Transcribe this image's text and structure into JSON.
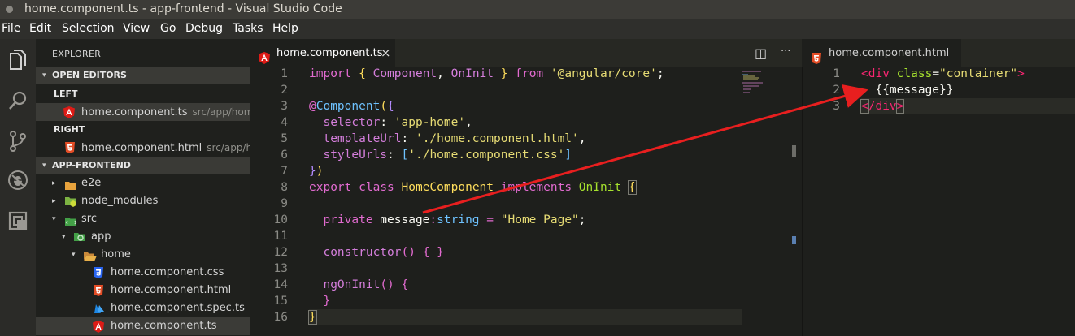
{
  "window": {
    "title": "home.component.ts - app-frontend - Visual Studio Code"
  },
  "menu": [
    "File",
    "Edit",
    "Selection",
    "View",
    "Go",
    "Debug",
    "Tasks",
    "Help"
  ],
  "activity_bar": [
    {
      "icon": "files-icon"
    },
    {
      "icon": "search-icon"
    },
    {
      "icon": "source-control-icon"
    },
    {
      "icon": "debug-icon"
    },
    {
      "icon": "extensions-icon"
    }
  ],
  "explorer": {
    "title": "EXPLORER",
    "open_editors": {
      "label": "OPEN EDITORS",
      "left_label": "LEFT",
      "left_file": "home.component.ts",
      "left_path": "src/app/home",
      "right_label": "RIGHT",
      "right_file": "home.component.html",
      "right_path": "src/app/h..."
    },
    "project_label": "APP-FRONTEND",
    "tree": [
      {
        "label": "e2e",
        "arrow": "▸"
      },
      {
        "label": "node_modules",
        "arrow": "▸"
      },
      {
        "label": "src",
        "arrow": "▾"
      },
      {
        "label": "app",
        "arrow": "▾"
      },
      {
        "label": "home",
        "arrow": "▾"
      },
      {
        "label": "home.component.css",
        "arrow": ""
      },
      {
        "label": "home.component.html",
        "arrow": ""
      },
      {
        "label": "home.component.spec.ts",
        "arrow": ""
      },
      {
        "label": "home.component.ts",
        "arrow": ""
      }
    ]
  },
  "editor_left": {
    "tab_label": "home.component.ts",
    "close_glyph": "×",
    "split_glyph": "◫",
    "more_glyph": "···",
    "line_numbers": [
      "1",
      "2",
      "3",
      "4",
      "5",
      "6",
      "7",
      "8",
      "9",
      "10",
      "11",
      "12",
      "13",
      "14",
      "15",
      "16"
    ]
  },
  "editor_right": {
    "tab_label": "home.component.html",
    "line_numbers": [
      "1",
      "2",
      "3"
    ]
  },
  "colors": {
    "accent_red": "#e81f1f",
    "angular_red": "#dd1b16",
    "html_orange": "#e44d26",
    "css_blue": "#2965f1"
  }
}
